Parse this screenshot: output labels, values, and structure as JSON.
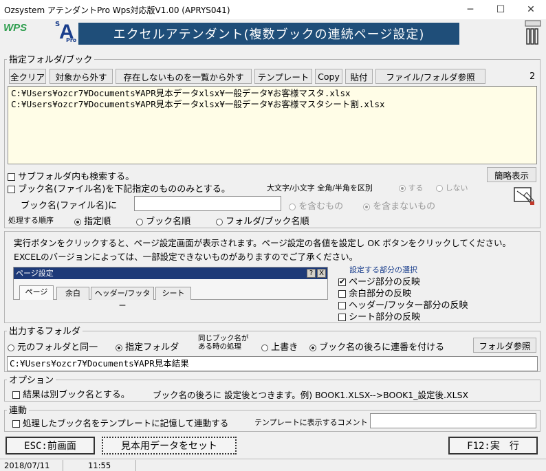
{
  "window": {
    "title": "Ozsystem アテンダントPro Wps対応版V1.00 (APRYS041)",
    "header": "エクセルアテンダント(複数ブックの連続ページ設定)",
    "wps_logo": "WPS",
    "logo_s": "S",
    "logo_a": "A",
    "logo_pro": "Pro"
  },
  "folder_section": {
    "title": "指定フォルダ/ブック",
    "buttons": [
      "全クリア",
      "対象から外す",
      "存在しないものを一覧から外す",
      "テンプレート",
      "Copy",
      "貼付",
      "ファイル/フォルダ参照"
    ],
    "count": "2",
    "files": [
      "C:¥Users¥ozcr7¥Documents¥APR見本データxlsx¥一般データ¥お客様マスタ.xlsx",
      "C:¥Users¥ozcr7¥Documents¥APR見本データxlsx¥一般データ¥お客様マスタシート割.xlsx"
    ],
    "subfolder_label": "サブフォルダ内も検索する。",
    "subfolder_checked": false,
    "brief_button": "簡略表示",
    "bookname_only_label": "ブック名(ファイル名)を下記指定のもののみとする。",
    "bookname_only_checked": false,
    "case_label": "大文字/小文字 全角/半角を区別",
    "case_options": [
      "する",
      "しない"
    ],
    "case_selected": "する",
    "bookname_label": "ブック名(ファイル名)に",
    "bookname_value": "",
    "match_options": [
      "を含むもの",
      "を含まないもの"
    ],
    "match_selected": "を含まないもの",
    "order_label": "処理する順序",
    "order_options": [
      "指定順",
      "ブック名順",
      "フォルダ/ブック名順"
    ],
    "order_selected": "指定順"
  },
  "info": {
    "line1": "実行ボタンをクリックすると、ページ設定画面が表示されます。ページ設定の各値を設定し OK ボタンをクリックしてください。",
    "line2": "EXCELのバージョンによっては、一部設定できないものがありますのでご了承ください。",
    "dialog_title": "ページ設定",
    "dialog_help": "?",
    "dialog_close": "X",
    "dialog_tabs": [
      "ページ",
      "余白",
      "ヘッダー/フッター",
      "シート"
    ],
    "reflect_title": "設定する部分の選択",
    "reflect_options": [
      {
        "label": "ページ部分の反映",
        "checked": true
      },
      {
        "label": "余白部分の反映",
        "checked": false
      },
      {
        "label": "ヘッダー/フッター部分の反映",
        "checked": false
      },
      {
        "label": "シート部分の反映",
        "checked": false
      }
    ]
  },
  "output": {
    "title": "出力するフォルダ",
    "folder_options": [
      "元のフォルダと同一",
      "指定フォルダ"
    ],
    "folder_selected": "指定フォルダ",
    "same_name_line1": "同じブック名が",
    "same_name_line2": "ある時の処理",
    "same_options": [
      "上書き",
      "ブック名の後ろに連番を付ける"
    ],
    "same_selected": "ブック名の後ろに連番を付ける",
    "browse_button": "フォルダ参照",
    "path": "C:¥Users¥ozcr7¥Documents¥APR見本結果"
  },
  "option": {
    "title": "オプション",
    "separate_label": "結果は別ブック名とする。",
    "separate_checked": false,
    "note": "ブック名の後ろに 設定後とつきます。例) BOOK1.XLSX-->BOOK1_設定後.XLSX"
  },
  "link": {
    "title": "連動",
    "template_label": "処理したブック名をテンプレートに記憶して連動する",
    "template_checked": false,
    "comment_label": "テンプレートに表示するコメント",
    "comment_value": ""
  },
  "footer": {
    "esc_button": "ESC:前画面",
    "sample_button": "見本用データをセット",
    "run_button": "F12:実　行"
  },
  "status": {
    "date": "2018/07/11",
    "time": "11:55"
  }
}
